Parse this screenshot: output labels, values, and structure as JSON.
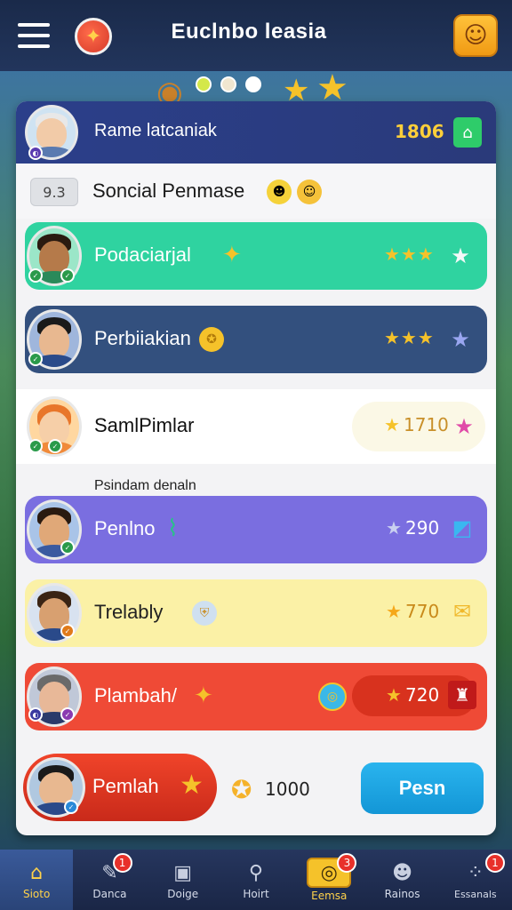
{
  "header": {
    "title": "Euclnbo leasia",
    "logo_glyph": "✦",
    "profile_glyph": "☺"
  },
  "carousel_dots": [
    "#d4e84a",
    "#f0e6d0",
    "#ffffff"
  ],
  "panel": {
    "header": {
      "name": "Rame latcaniak",
      "score": "1806",
      "icon": "⌂"
    },
    "subheader": {
      "rank": "9.3",
      "title": "Soncial Penmase"
    },
    "section_label": "Psindam denaln",
    "rows": [
      {
        "name": "Podaciarjal",
        "stars": "★★★",
        "end_icon": "★",
        "bg": "#2fd3a0",
        "text_color": "#ffffff"
      },
      {
        "name": "Perbiiakian",
        "stars": "★★★",
        "end_icon": "★",
        "bg": "#33507e",
        "text_color": "#ffffff"
      },
      {
        "name": "SamlPimlar",
        "score": "1710",
        "end_icon": "★",
        "bg": "#ffffff",
        "text_color": "#111111"
      },
      {
        "name": "Penlno",
        "score": "290",
        "end_icon": "◩",
        "bg": "#7a6ee0",
        "text_color": "#ffffff"
      },
      {
        "name": "Trelably",
        "score": "770",
        "end_icon": "✉",
        "bg": "#fbf1a6",
        "text_color": "#222222"
      },
      {
        "name": "Plambah/",
        "score": "720",
        "end_icon": "♜",
        "bg": "#ef4a36",
        "text_color": "#ffffff"
      }
    ],
    "footer": {
      "name": "Pemlah",
      "coins": "1000",
      "play_label": "Pesn"
    }
  },
  "nav": [
    {
      "label": "Sioto",
      "icon": "⌂",
      "badge": ""
    },
    {
      "label": "Danca",
      "icon": "✎",
      "badge": "1"
    },
    {
      "label": "Doige",
      "icon": "▣",
      "badge": ""
    },
    {
      "label": "Hoirt",
      "icon": "⚲",
      "badge": ""
    },
    {
      "label": "Eemsa",
      "icon": "◎",
      "badge": "3"
    },
    {
      "label": "Rainos",
      "icon": "☻",
      "badge": ""
    },
    {
      "label": "Essanals",
      "icon": "⁘",
      "badge": "1"
    }
  ]
}
